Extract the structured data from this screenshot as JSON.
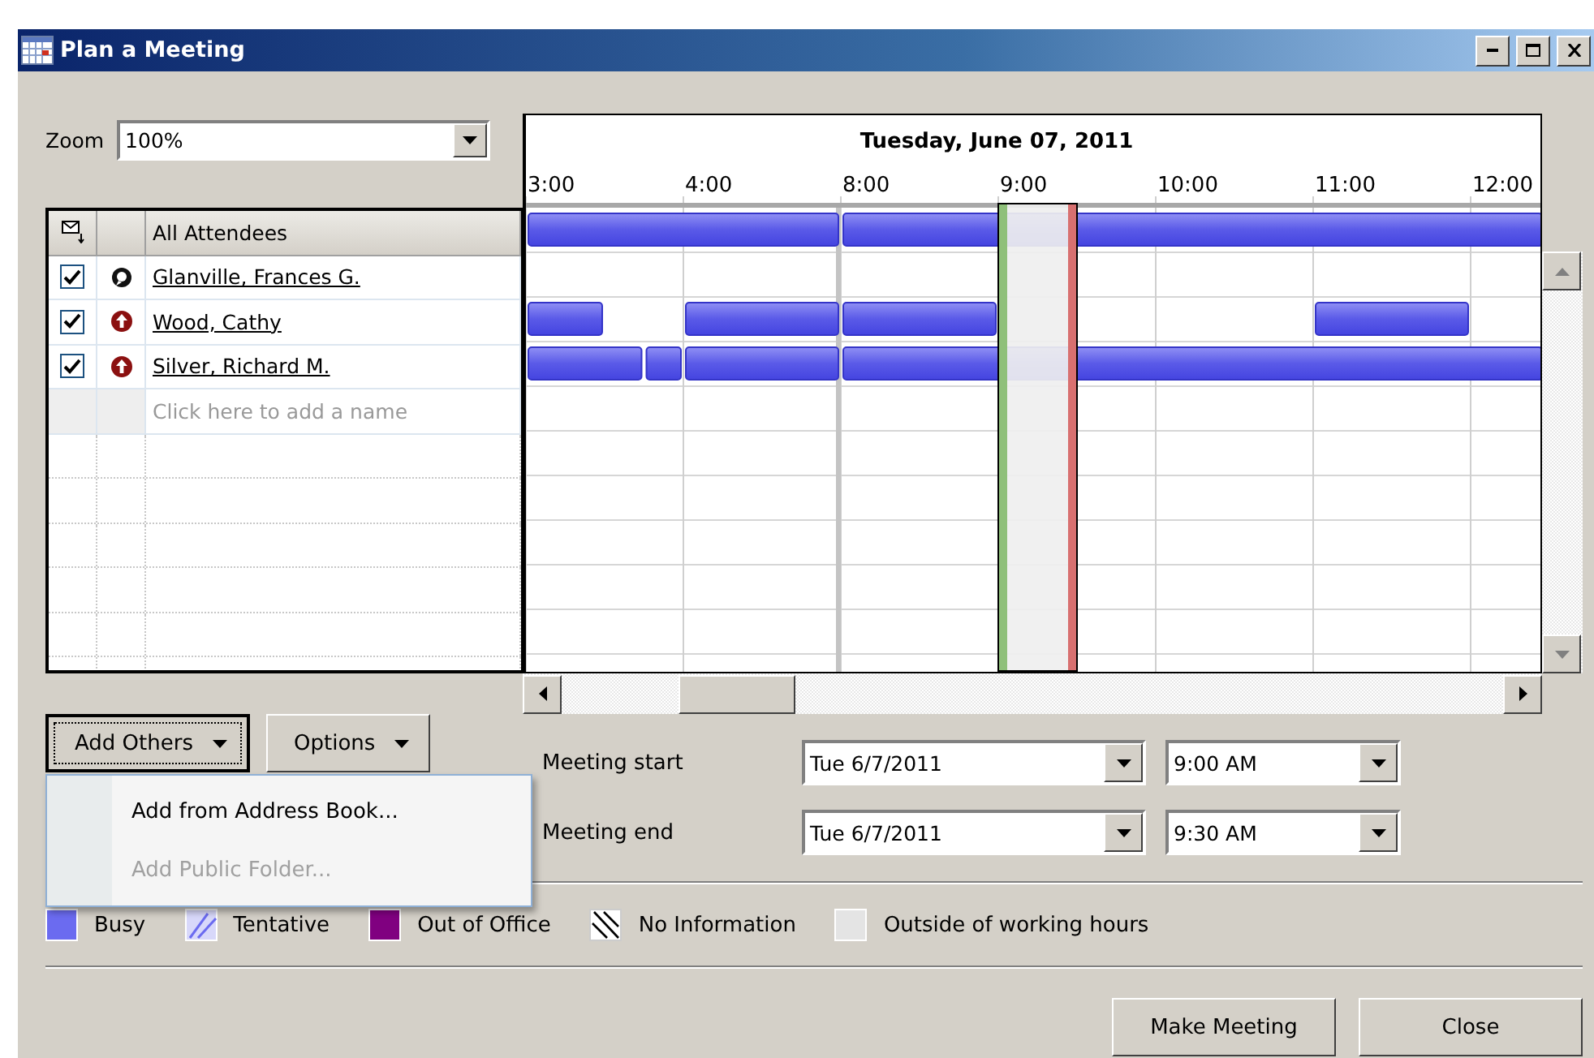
{
  "window": {
    "title": "Plan a Meeting"
  },
  "zoom": {
    "label": "Zoom",
    "value": "100%"
  },
  "attendees": {
    "header": "All Attendees",
    "add_placeholder": "Click here to add a name",
    "rows": [
      {
        "name": "Glanville, Frances G.",
        "checked": true,
        "kind": "organizer"
      },
      {
        "name": "Wood, Cathy",
        "checked": true,
        "kind": "required"
      },
      {
        "name": "Silver, Richard M.",
        "checked": true,
        "kind": "required"
      }
    ]
  },
  "timeline": {
    "date": "Tuesday, June 07, 2011",
    "hours": [
      "3:00",
      "4:00",
      "8:00",
      "9:00",
      "10:00",
      "11:00",
      "12:00"
    ]
  },
  "add_others": {
    "label": "Add Others",
    "expanded": true
  },
  "options": {
    "label": "Options"
  },
  "menu": [
    {
      "label": "Add from Address Book...",
      "disabled": false
    },
    {
      "label": "Add Public Folder...",
      "disabled": true
    }
  ],
  "meeting": [
    {
      "label": "Meeting start",
      "date": "Tue 6/7/2011",
      "time": "9:00 AM"
    },
    {
      "label": "Meeting end",
      "date": "Tue 6/7/2011",
      "time": "9:30 AM"
    }
  ],
  "legend": [
    {
      "kind": "busy",
      "label": "Busy"
    },
    {
      "kind": "tentative",
      "label": "Tentative"
    },
    {
      "kind": "out-of-office",
      "label": "Out of Office"
    },
    {
      "kind": "no-information",
      "label": "No Information"
    },
    {
      "kind": "outside-hours",
      "label": "Outside of working hours"
    }
  ],
  "buttons": [
    "Make Meeting",
    "Close"
  ]
}
